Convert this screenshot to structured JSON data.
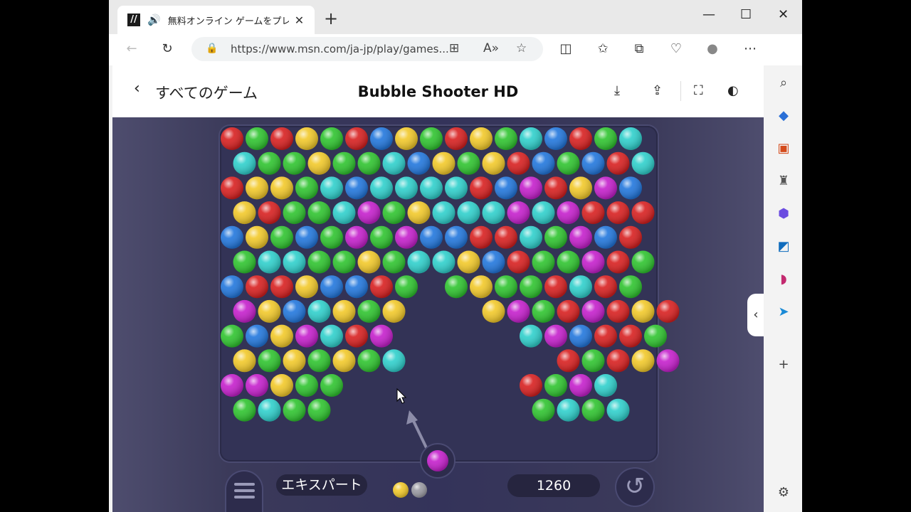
{
  "tab": {
    "favicon": "msn-games-favicon",
    "audio_icon": "speaker-icon",
    "title": "無料オンライン ゲームをプレイ | M",
    "close": "✕"
  },
  "window_controls": {
    "minimize": "—",
    "maximize": "☐",
    "close": "✕",
    "new_tab": "+"
  },
  "address_bar": {
    "url": "https://www.msn.com/ja-jp/play/games..."
  },
  "game_header": {
    "back_label": "すべてのゲーム",
    "title": "Bubble Shooter HD"
  },
  "game": {
    "difficulty": "エキスパート",
    "score": "1260",
    "colors": {
      "R": "#d82020",
      "G": "#2fc42f",
      "Y": "#f2c92a",
      "C": "#2fd0cc",
      "B": "#2277dd",
      "M": "#c51fcc",
      "S": "#9a9aa2"
    },
    "rows": [
      "RGRYGRBYGRYGCBRGC",
      "CGGYGGCBYGYRBGBRC",
      "RYYGCBCCCCRBMRYMB",
      "YRGGCMGYCCCMCMRRR",
      "BYGBGMGMBBRRCGMBR",
      "GCCGGYGCCYBRGGMRG",
      "BRRYBBRG.GYGGRCRG",
      "MYBCYGY...YMGRMRYR",
      "GBYMCRM.....CMBRRG",
      "YGYGYGC......RGRYM",
      "MMYGG.......RGMC",
      "GCGG........GCGC"
    ],
    "shooter_ball": "M",
    "next_balls": [
      "Y",
      "S"
    ]
  },
  "sidebar": {
    "icons": [
      "search-icon",
      "tag-icon",
      "toolbox-icon",
      "chess-icon",
      "copilot-icon",
      "outlook-icon",
      "designer-icon",
      "send-icon",
      "add-icon",
      "settings-icon"
    ]
  }
}
